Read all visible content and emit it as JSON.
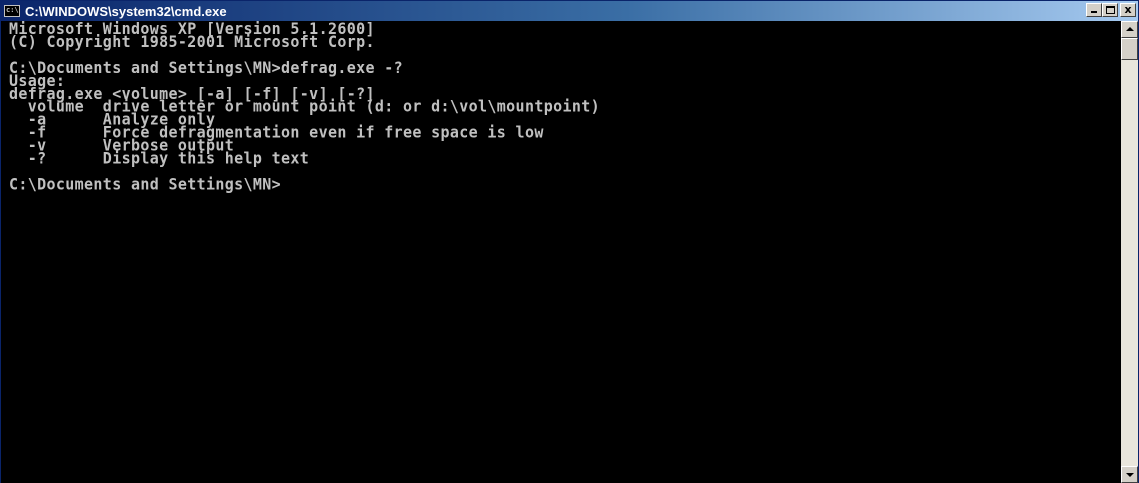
{
  "window": {
    "title": "C:\\WINDOWS\\system32\\cmd.exe",
    "icon": "console-icon"
  },
  "caption_buttons": {
    "minimize": "minimize-icon",
    "maximize": "maximize-icon",
    "close_label": "x"
  },
  "console": {
    "lines": [
      "Microsoft Windows XP [Version 5.1.2600]",
      "(C) Copyright 1985-2001 Microsoft Corp.",
      "",
      "C:\\Documents and Settings\\MN>defrag.exe -?",
      "Usage:",
      "defrag.exe <volume> [-a] [-f] [-v] [-?]",
      "  volume  drive letter or mount point (d: or d:\\vol\\mountpoint)",
      "  -a      Analyze only",
      "  -f      Force defragmentation even if free space is low",
      "  -v      Verbose output",
      "  -?      Display this help text",
      "",
      "C:\\Documents and Settings\\MN>"
    ]
  },
  "colors": {
    "console_bg": "#000000",
    "console_fg": "#c0c0c0",
    "titlebar_start": "#0a246a",
    "titlebar_end": "#a6caf0"
  }
}
